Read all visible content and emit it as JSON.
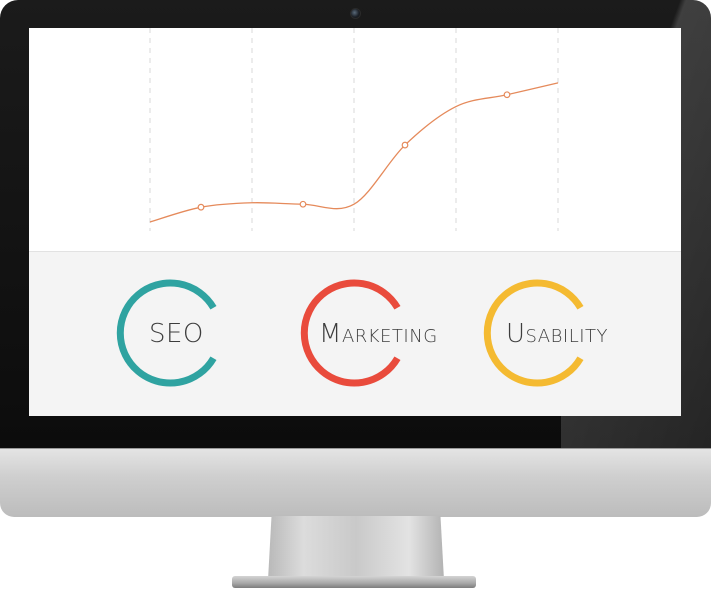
{
  "colors": {
    "seo": "#2fa3a1",
    "marketing": "#e94b3c",
    "usability": "#f4ba31",
    "chart_line": "#e58a5b",
    "gridline": "#d8d8d8"
  },
  "chart_data": {
    "type": "line",
    "title": "",
    "xlabel": "",
    "ylabel": "",
    "grid": "vertical dashed",
    "x": [
      0,
      1,
      2,
      3,
      4,
      5,
      6,
      7,
      8
    ],
    "values": [
      0,
      0.1,
      0.13,
      0.12,
      0.12,
      0.52,
      0.78,
      0.86,
      0.94
    ],
    "markers": [
      1,
      3,
      5,
      7
    ],
    "ylim": [
      0,
      1
    ]
  },
  "features": [
    {
      "cap": "SEO",
      "rest": "",
      "color_key": "seo",
      "icon": "open-ring-icon"
    },
    {
      "cap": "M",
      "rest": "arketing",
      "color_key": "marketing",
      "icon": "open-ring-icon"
    },
    {
      "cap": "U",
      "rest": "sability",
      "color_key": "usability",
      "icon": "open-ring-icon"
    }
  ]
}
